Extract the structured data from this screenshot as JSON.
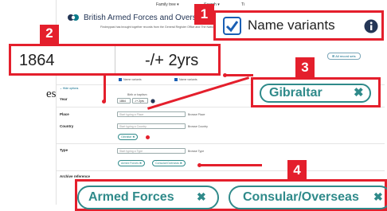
{
  "side_text": "es",
  "nav": {
    "family_tree": "Family tree ▾",
    "search": "Search ▾",
    "extra": "Ti"
  },
  "page": {
    "title": "British Armed Forces and Overs",
    "description": "Findmypast has brought together records from the General Register Office and The National Archives in one collection of birth and baptism ... to those working within the armed forces",
    "all_records": "⊞ All record sets"
  },
  "options": {
    "name_variants_label": "Name variants",
    "name_variants2_label": "Name variants",
    "hide_label": "⌄ Hide options"
  },
  "fields": {
    "year": {
      "label": "Year",
      "hint": "Birth or baptism",
      "value": "1864",
      "range": "-/+ 2yrs"
    },
    "place": {
      "label": "Place",
      "placeholder": "Start typing a Place",
      "hint": "Browse Place"
    },
    "country": {
      "label": "Country",
      "placeholder": "Start typing a Country",
      "hint": "Browse Country",
      "chip": "Gibraltar ✖"
    },
    "type": {
      "label": "Type",
      "placeholder": "Start typing a Type",
      "hint": "Browse Type",
      "chips": [
        "Armed Forces ✖",
        "Consular/Overseas ✖"
      ]
    },
    "archive": {
      "label": "Archive reference"
    }
  },
  "callouts": {
    "c1": {
      "badge": "1",
      "label": "Name variants"
    },
    "c2": {
      "badge": "2",
      "year": "1864",
      "range": "-/+ 2yrs"
    },
    "c3": {
      "badge": "3",
      "label": "Gibraltar"
    },
    "c4": {
      "badge": "4",
      "chips": [
        "Armed Forces",
        "Consular/Overseas"
      ]
    }
  },
  "colors": {
    "badge": "#e41f2c",
    "accent": "#2f8a8a",
    "checkbox": "#1a5fb4"
  },
  "icons": [
    "check-icon",
    "info-icon",
    "close-icon",
    "chevron-down-icon"
  ]
}
